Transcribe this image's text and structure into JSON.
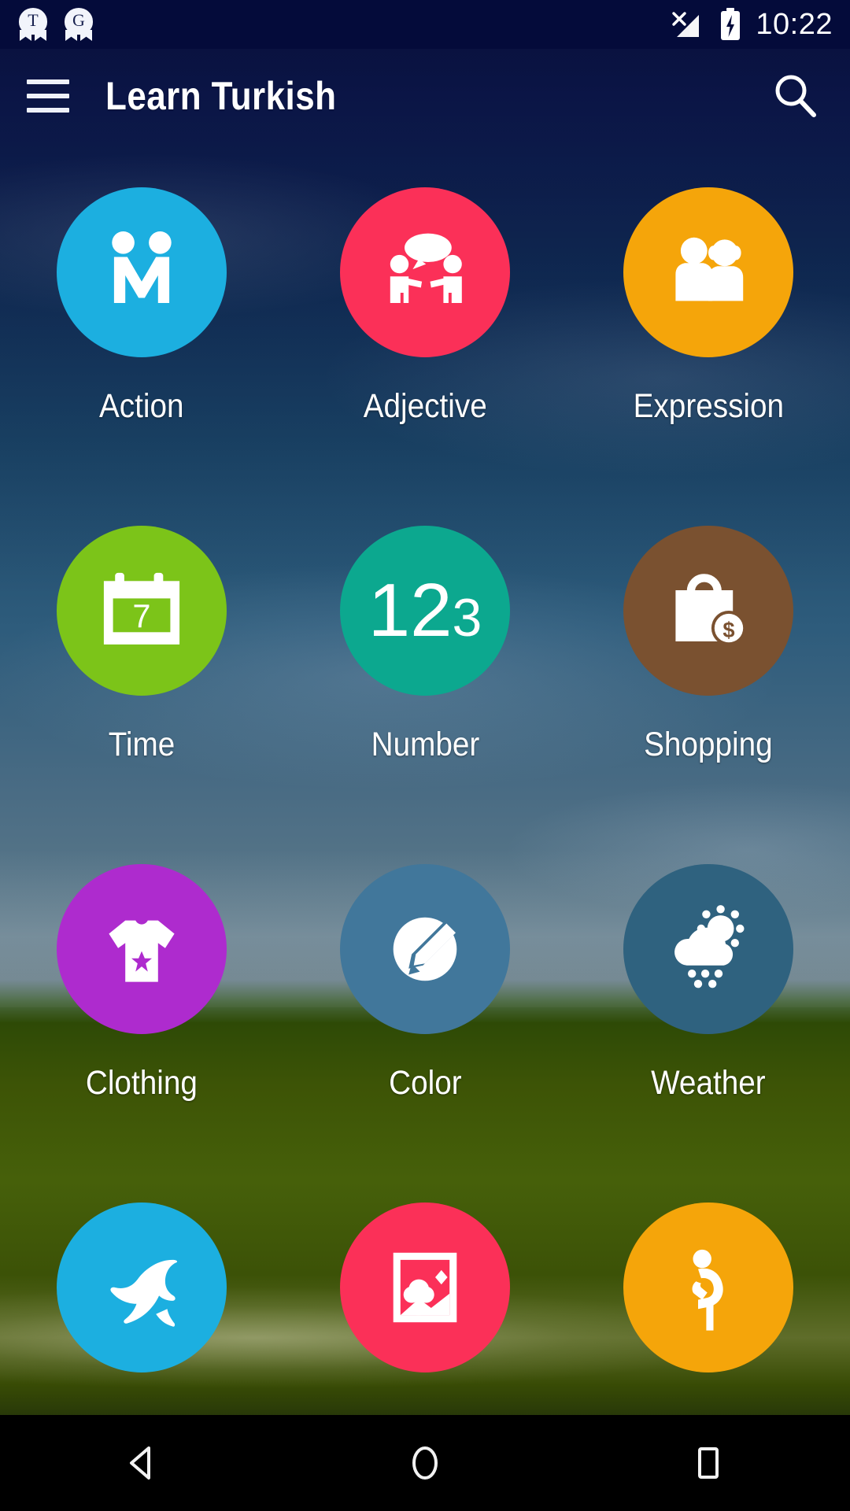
{
  "status_bar": {
    "notifications": [
      {
        "name": "notification-badge-t",
        "letter": "T"
      },
      {
        "name": "notification-badge-g",
        "letter": "G"
      }
    ],
    "signal_icon": "signal-no-service-icon",
    "battery_icon": "battery-charging-icon",
    "time": "10:22",
    "background_color": "#040b3a"
  },
  "app_bar": {
    "menu_icon": "hamburger-menu-icon",
    "title": "Learn Turkish",
    "search_icon": "search-icon"
  },
  "categories": [
    {
      "label": "Action",
      "icon": "handshake-icon",
      "color": "#1CAFE0"
    },
    {
      "label": "Adjective",
      "icon": "people-speech-icon",
      "color": "#FB3058"
    },
    {
      "label": "Expression",
      "icon": "couple-icon",
      "color": "#F5A50A"
    },
    {
      "label": "Time",
      "icon": "calendar-icon",
      "color": "#7CC419",
      "badge": "7"
    },
    {
      "label": "Number",
      "icon": "numbers-123-icon",
      "color": "#0CA88F",
      "big": "12",
      "small": "3"
    },
    {
      "label": "Shopping",
      "icon": "shopping-bag-dollar-icon",
      "color": "#7A5130"
    },
    {
      "label": "Clothing",
      "icon": "tshirt-star-icon",
      "color": "#AE2BCE"
    },
    {
      "label": "Color",
      "icon": "palette-pencil-icon",
      "color": "#41779B"
    },
    {
      "label": "Weather",
      "icon": "cloud-sun-rain-icon",
      "color": "#2F627F"
    },
    {
      "label": "",
      "icon": "dolphin-icon",
      "color": "#1CAFE0"
    },
    {
      "label": "",
      "icon": "nature-photo-icon",
      "color": "#FB3058"
    },
    {
      "label": "",
      "icon": "person-bending-icon",
      "color": "#F5A50A"
    }
  ],
  "nav_bar": {
    "back": "back-triangle-icon",
    "home": "home-circle-icon",
    "recents": "recents-square-icon",
    "background_color": "#000000"
  },
  "theme": {
    "sky_top": "#0b1440",
    "sky_mid": "#2e5c7c",
    "grass": "#3d5406",
    "label_color": "#ffffff"
  }
}
